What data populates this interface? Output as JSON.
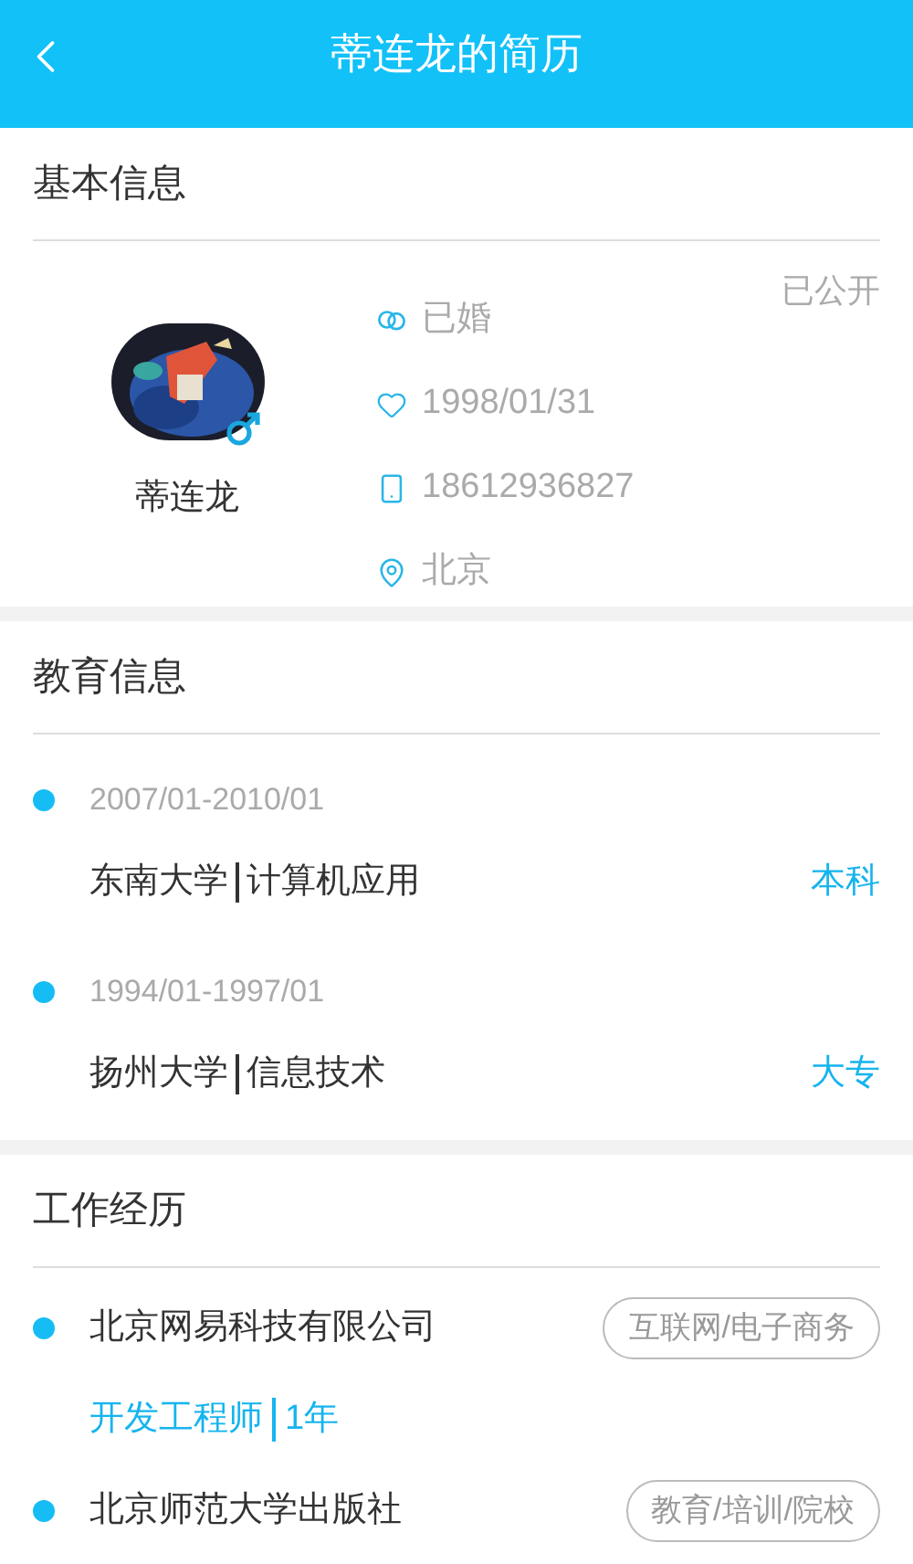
{
  "header": {
    "title": "蒂连龙的简历"
  },
  "basic": {
    "title": "基本信息",
    "visibility": "已公开",
    "name": "蒂连龙",
    "male": true,
    "details": [
      {
        "kind": "marital",
        "text": "已婚"
      },
      {
        "kind": "birthday",
        "text": "1998/01/31"
      },
      {
        "kind": "phone",
        "text": "18612936827"
      },
      {
        "kind": "location",
        "text": "北京"
      }
    ]
  },
  "education": {
    "title": "教育信息",
    "items": [
      {
        "period": "2007/01-2010/01",
        "school": "东南大学",
        "major": "计算机应用",
        "degree": "本科"
      },
      {
        "period": "1994/01-1997/01",
        "school": "扬州大学",
        "major": "信息技术",
        "degree": "大专"
      }
    ]
  },
  "work": {
    "title": "工作经历",
    "items": [
      {
        "company": "北京网易科技有限公司",
        "industry": "互联网/电子商务",
        "position": "开发工程师",
        "duration": "1年"
      },
      {
        "company": "北京师范大学出版社",
        "industry": "教育/培训/院校"
      }
    ]
  }
}
